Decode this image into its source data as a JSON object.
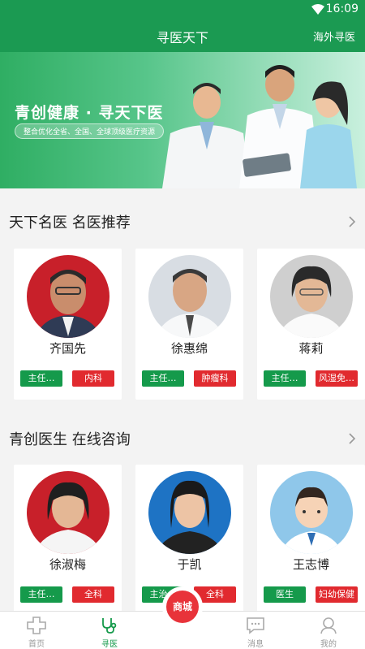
{
  "status_bar": {
    "time": "16:09",
    "wifi_icon": "wifi-icon"
  },
  "app_bar": {
    "title": "寻医天下",
    "right_action": "海外寻医"
  },
  "banner": {
    "slogan": "青创健康 · 寻天下医",
    "subtitle": "整合优化全省、全国、全球顶级医疗资源"
  },
  "section_famous": {
    "title": "天下名医 名医推荐",
    "doctors": [
      {
        "name": "齐国先",
        "title_tag": "主任…",
        "dept_tag": "内科"
      },
      {
        "name": "徐惠绵",
        "title_tag": "主任…",
        "dept_tag": "肿瘤科"
      },
      {
        "name": "蒋莉",
        "title_tag": "主任…",
        "dept_tag": "风湿免…"
      }
    ]
  },
  "section_online": {
    "title": "青创医生 在线咨询",
    "doctors": [
      {
        "name": "徐淑梅",
        "title_tag": "主任…",
        "dept_tag": "全科"
      },
      {
        "name": "于凯",
        "title_tag": "主治…",
        "dept_tag": "全科"
      },
      {
        "name": "王志博",
        "title_tag": "医生",
        "dept_tag": "妇幼保健"
      }
    ]
  },
  "bottom_nav": {
    "items": [
      {
        "label": "首页",
        "icon": "home-cross-icon"
      },
      {
        "label": "寻医",
        "icon": "stethoscope-icon"
      },
      {
        "label": "消息",
        "icon": "message-icon"
      },
      {
        "label": "我的",
        "icon": "profile-icon"
      }
    ],
    "mall_label": "商城",
    "active": "寻医"
  },
  "colors": {
    "primary": "#1b9a52",
    "tag_green": "#159a4b",
    "tag_red": "#e12a2f"
  }
}
